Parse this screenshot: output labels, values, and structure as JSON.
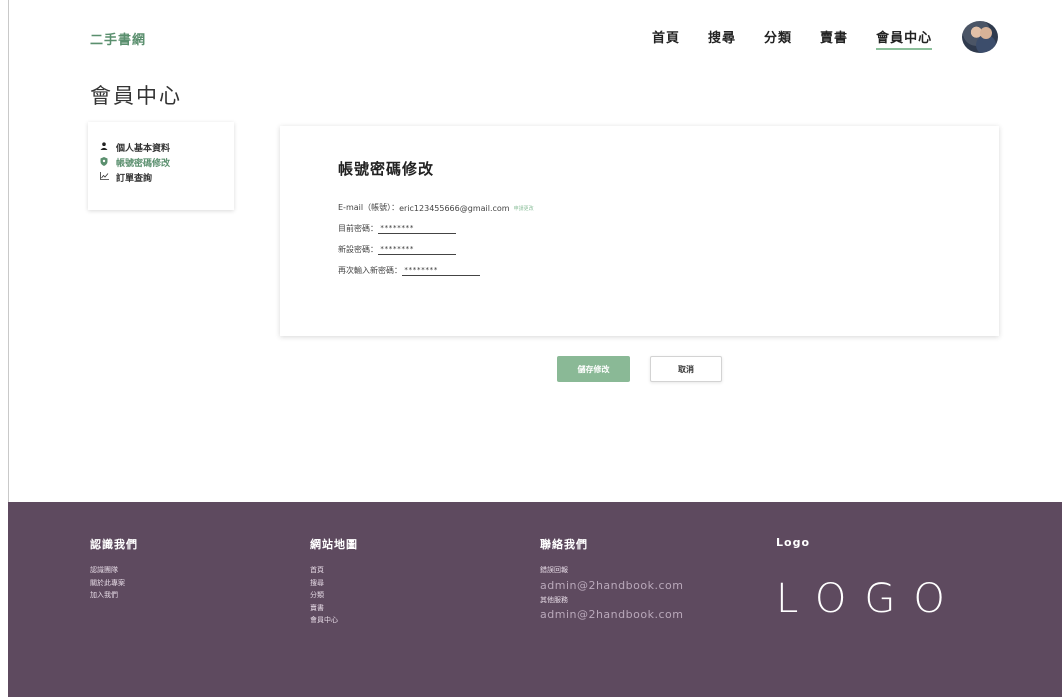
{
  "header": {
    "brand": "二手書網",
    "nav": [
      "首頁",
      "搜尋",
      "分類",
      "賣書",
      "會員中心"
    ],
    "active_nav": "會員中心"
  },
  "page_title": "會員中心",
  "sidebar": {
    "items": [
      {
        "label": "個人基本資料",
        "icon": "user-icon"
      },
      {
        "label": "帳號密碼修改",
        "icon": "shield-icon"
      },
      {
        "label": "訂單查詢",
        "icon": "chart-icon"
      }
    ],
    "active_index": 1
  },
  "form": {
    "title": "帳號密碼修改",
    "email_label": "E-mail（帳號）：",
    "email_value": "eric123455666@gmail.com",
    "verify_link": "申請更改",
    "current_pw_label": "目前密碼：",
    "current_pw_value": "********",
    "new_pw_label": "新設密碼：",
    "new_pw_value": "********",
    "repeat_pw_label": "再次輸入新密碼：",
    "repeat_pw_value": "********"
  },
  "buttons": {
    "save": "儲存修改",
    "cancel": "取消"
  },
  "footer": {
    "about": {
      "title": "認識我們",
      "links": [
        "認識團隊",
        "關於此專案",
        "加入我們"
      ]
    },
    "sitemap": {
      "title": "網站地圖",
      "links": [
        "首頁",
        "搜尋",
        "分類",
        "賣書",
        "會員中心"
      ]
    },
    "contact": {
      "title": "聯絡我們",
      "error_label": "錯誤回報",
      "error_email": "admin@2handbook.com",
      "other_label": "其他服務",
      "other_email": "admin@2handbook.com"
    },
    "logo": {
      "title": "Logo",
      "text": "LOGO"
    }
  },
  "colors": {
    "accent": "#5a8f6e",
    "save_button": "#8ab996",
    "footer_bg": "#5e4a5f"
  }
}
